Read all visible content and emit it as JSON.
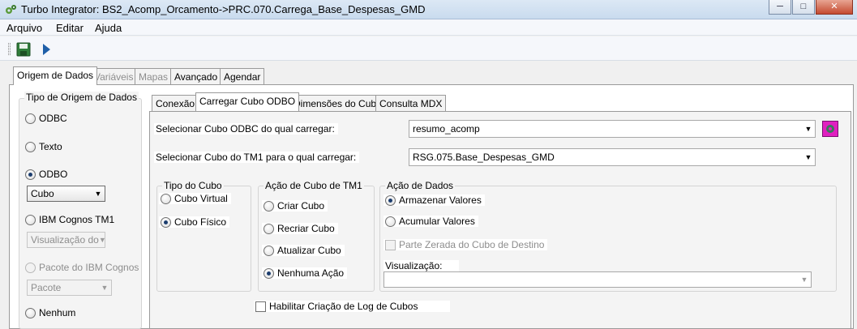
{
  "window": {
    "title": "Turbo Integrator:  BS2_Acomp_Orcamento->PRC.070.Carrega_Base_Despesas_GMD",
    "minimize": "─",
    "maximize": "□",
    "close": "✕"
  },
  "menu": {
    "items": [
      {
        "label": "Arquivo"
      },
      {
        "label": "Editar"
      },
      {
        "label": "Ajuda"
      }
    ]
  },
  "toolbar": {
    "save_icon": "save-icon",
    "run_icon": "run-icon"
  },
  "main_tabs": [
    {
      "label": "Origem de Dados",
      "active": true
    },
    {
      "label": "Variáveis",
      "disabled": true
    },
    {
      "label": "Mapas",
      "disabled": true
    },
    {
      "label": "Avançado"
    },
    {
      "label": "Agendar"
    }
  ],
  "source_type": {
    "group_label": "Tipo de Origem de Dados",
    "options": [
      {
        "label": "ODBC",
        "checked": false
      },
      {
        "label": "Texto",
        "checked": false
      },
      {
        "label": "ODBO",
        "checked": true
      },
      {
        "label": "IBM Cognos TM1",
        "checked": false
      },
      {
        "label": "Pacote do IBM Cognos",
        "checked": false,
        "disabled": true
      },
      {
        "label": "Nenhum",
        "checked": false
      }
    ],
    "odbo_combo": "Cubo",
    "tm1_combo": "Visualização do",
    "package_combo": "Pacote"
  },
  "sub_tabs": [
    {
      "label": "Conexão"
    },
    {
      "label": "Carregar Cubo ODBO",
      "active": true
    },
    {
      "label": "Dimensões do Cubo"
    },
    {
      "label": "Consulta MDX"
    }
  ],
  "form": {
    "odbc_cube_label": "Selecionar Cubo ODBC do qual carregar:",
    "odbc_cube_value": "resumo_acomp",
    "tm1_cube_label": "Selecionar Cubo do TM1 para o qual carregar:",
    "tm1_cube_value": "RSG.075.Base_Despesas_GMD",
    "refresh_icon": "refresh-cube-icon",
    "accent_color": "#e020c0"
  },
  "cube_type": {
    "label": "Tipo do Cubo",
    "options": [
      {
        "label": "Cubo Virtual",
        "checked": false
      },
      {
        "label": "Cubo Físico",
        "checked": true
      }
    ]
  },
  "tm1_action": {
    "label": "Ação de Cubo de TM1",
    "options": [
      {
        "label": "Criar Cubo",
        "checked": false
      },
      {
        "label": "Recriar Cubo",
        "checked": false
      },
      {
        "label": "Atualizar Cubo",
        "checked": false
      },
      {
        "label": "Nenhuma Ação",
        "checked": true
      }
    ]
  },
  "data_action": {
    "label": "Ação de Dados",
    "options": [
      {
        "label": "Armazenar Valores",
        "checked": true
      },
      {
        "label": "Acumular Valores",
        "checked": false
      }
    ],
    "zero_out_label": "Parte Zerada do Cubo de Destino",
    "view_label": "Visualização:",
    "view_value": ""
  },
  "log_checkbox": "Habilitar Criação de Log de Cubos"
}
